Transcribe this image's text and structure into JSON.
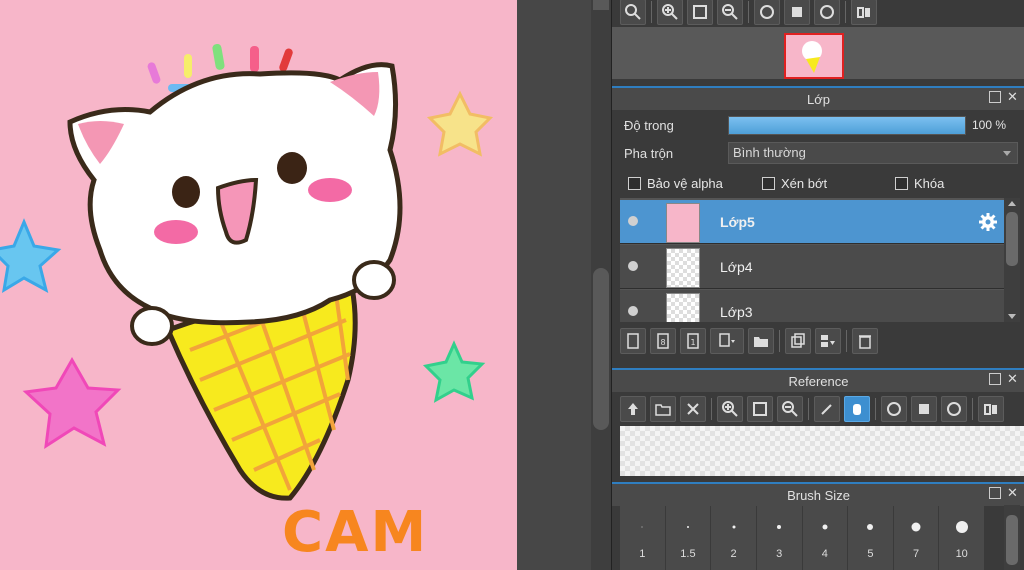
{
  "canvas": {
    "signature_text": "CAM"
  },
  "view_toolbar": {
    "icons": [
      "zoom-fit-icon",
      "zoom-in-icon",
      "fit-screen-icon",
      "zoom-out-icon",
      "rotate-left-icon",
      "reset-view-icon",
      "rotate-right-icon",
      "flip-horizontal-icon"
    ]
  },
  "layer_panel": {
    "title": "Lớp",
    "opacity_label": "Độ trong",
    "opacity_value": "100 %",
    "opacity": 1.0,
    "blend_label": "Pha trộn",
    "blend_value": "Bình thường",
    "checkboxes": {
      "alpha_protect": "Bảo vệ alpha",
      "clipping": "Xén bớt",
      "lock": "Khóa"
    },
    "layers": [
      {
        "name": "Lớp5",
        "selected": true
      },
      {
        "name": "Lớp4",
        "selected": false
      },
      {
        "name": "Lớp3",
        "selected": false
      }
    ]
  },
  "reference_panel": {
    "title": "Reference"
  },
  "brush_panel": {
    "title": "Brush Size",
    "sizes": [
      "1",
      "1.5",
      "2",
      "3",
      "4",
      "5",
      "7",
      "10"
    ]
  },
  "colors": {
    "accent": "#4d95d0",
    "canvas_bg": "#f7b6c9",
    "panel_bg": "#3a3a3a"
  }
}
